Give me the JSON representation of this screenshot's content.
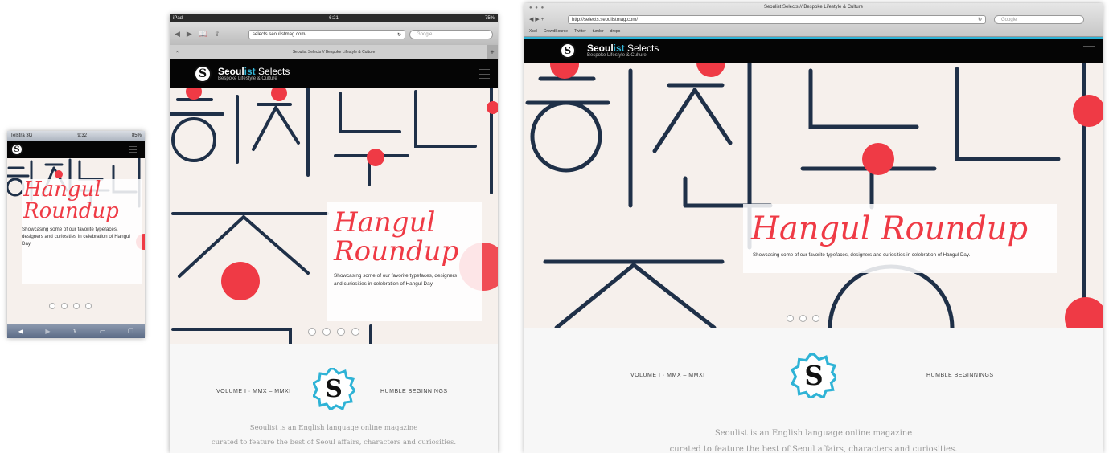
{
  "colors": {
    "accent_red": "#ef3a45",
    "brand_cyan": "#35b5d6",
    "stroke_navy": "#1f3048",
    "header_black": "#050505"
  },
  "brand": {
    "logo_letter": "S",
    "name_bold_1": "Seoul",
    "name_accent": "ist",
    "name_light": " Selects",
    "tagline": "Bespoke Lifestyle & Culture"
  },
  "hero": {
    "title_line1": "Hangul",
    "title_line2": "Roundup",
    "title_full": "Hangul Roundup",
    "subtitle": "Showcasing some of our favorite typefaces, designers and curiosities in celebration of Hangul Day."
  },
  "lower": {
    "volume": "VOLUME I · MMX – MMXI",
    "motto": "HUMBLE BEGINNINGS",
    "intro_line1": "Seoulist is an English language online magazine",
    "intro_line2": "curated to feature the best of Seoul affairs, characters and curiosities."
  },
  "phone": {
    "carrier": "Telstra 3G",
    "time": "9:32",
    "battery": "85%"
  },
  "tablet": {
    "status_left": "iPad",
    "time": "6:21",
    "battery": "75%",
    "url": "selects.seoulistmag.com/",
    "search_placeholder": "Google",
    "tab_title": "Seoulist Selects // Bespoke Lifestyle & Culture"
  },
  "desktop": {
    "window_title": "Seoulist Selects // Bespoke Lifestyle & Culture",
    "url": "http://selects.seoulistmag.com/",
    "search_placeholder": "Google",
    "bookmarks": [
      "Xcel",
      "CrowdSource",
      "Twitter",
      "tumblr",
      "dropo"
    ]
  },
  "icons": [
    "menu-icon",
    "back-arrow-icon",
    "forward-arrow-icon",
    "bookmarks-icon",
    "share-icon",
    "tabs-icon",
    "reload-icon",
    "add-tab-icon"
  ]
}
